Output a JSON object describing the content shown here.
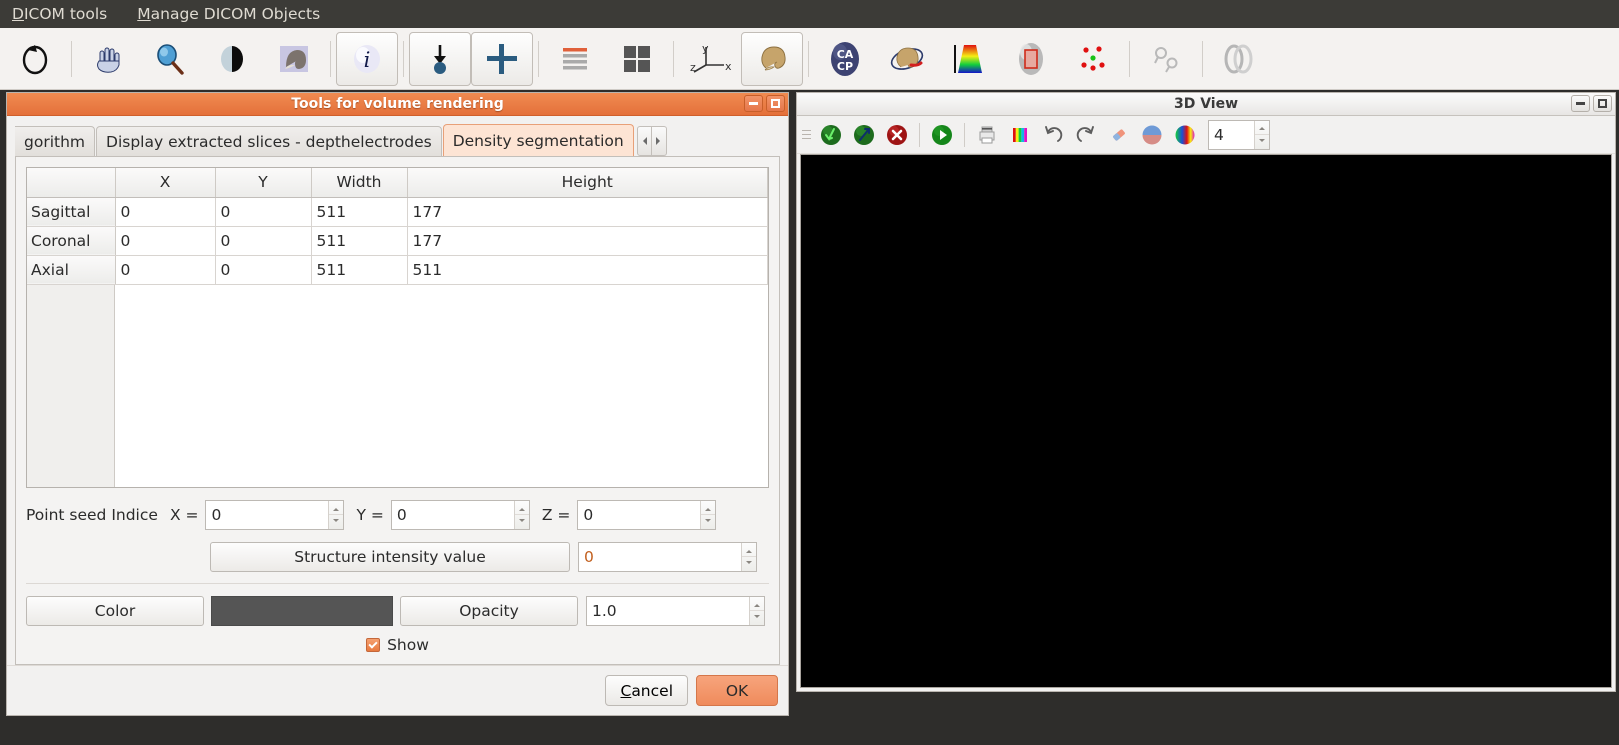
{
  "menubar": {
    "items": [
      {
        "name": "dicom-tools",
        "label": "DICOM tools",
        "accel": "D",
        "rest": "ICOM tools"
      },
      {
        "name": "manage-dicom-objects",
        "label": "Manage DICOM Objects",
        "accel": "M",
        "rest": "anage DICOM Objects"
      }
    ]
  },
  "toolbar": {
    "buttons": [
      {
        "icon": "rotate-icon",
        "label": "Rotate"
      },
      {
        "icon": "pan-hand-icon",
        "label": "Pan"
      },
      {
        "icon": "zoom-magnifier-icon",
        "label": "Zoom"
      },
      {
        "icon": "window-level-contrast-icon",
        "label": "Window level"
      },
      {
        "icon": "volume-render-icon",
        "label": "Volume rendering"
      },
      {
        "icon": "info-icon",
        "label": "Information"
      },
      {
        "icon": "seed-point-icon",
        "label": "Seed point"
      },
      {
        "icon": "crosshair-icon",
        "label": "Crosshair"
      },
      {
        "icon": "single-layout-icon",
        "label": "Single layout"
      },
      {
        "icon": "quad-layout-icon",
        "label": "Quad layout"
      },
      {
        "icon": "axes-orientation-icon",
        "label": "Axes orientation"
      },
      {
        "icon": "skull-3d-icon",
        "label": "3D skull view"
      },
      {
        "icon": "ca-cp-icon",
        "label": "CA CP",
        "text": "CA\nCP"
      },
      {
        "icon": "skull-rotation-icon",
        "label": "Skull rotation"
      },
      {
        "icon": "colormap-ramp-icon",
        "label": "Color map"
      },
      {
        "icon": "roi-box-icon",
        "label": "Region of interest"
      },
      {
        "icon": "points-cloud-icon",
        "label": "Point cloud"
      },
      {
        "icon": "registration-icon",
        "label": "Registration"
      },
      {
        "icon": "fusion-rings-icon",
        "label": "Image fusion"
      }
    ],
    "pressed": [
      "info-icon",
      "seed-point-icon",
      "crosshair-icon",
      "skull-3d-icon"
    ]
  },
  "dialog": {
    "title": "Tools for volume rendering",
    "window_buttons": {
      "minimize": "minimize-button",
      "maximize": "maximize-button"
    },
    "tabs": [
      {
        "label": "gorithm",
        "selected": false,
        "clipped": true
      },
      {
        "label": "Display extracted slices - depthelectrodes",
        "selected": false,
        "clipped": false
      },
      {
        "label": "Density segmentation",
        "selected": true,
        "clipped": false
      }
    ],
    "table": {
      "corner": "",
      "columns": [
        "X",
        "Y",
        "Width",
        "Height"
      ],
      "rows": [
        {
          "header": "Sagittal",
          "cells": [
            "0",
            "0",
            "511",
            "177"
          ]
        },
        {
          "header": "Coronal",
          "cells": [
            "0",
            "0",
            "511",
            "177"
          ]
        },
        {
          "header": "Axial",
          "cells": [
            "0",
            "0",
            "511",
            "511"
          ]
        }
      ]
    },
    "seed": {
      "label": "Point seed Indice",
      "x_label": "X =",
      "x_value": "0",
      "y_label": "Y =",
      "y_value": "0",
      "z_label": "Z =",
      "z_value": "0"
    },
    "intensity": {
      "button_label": "Structure intensity value",
      "value": "0"
    },
    "appearance": {
      "color_button": "Color",
      "color_swatch": "#555555",
      "opacity_button": "Opacity",
      "opacity_value": "1.0"
    },
    "show": {
      "label": "Show",
      "checked": true
    },
    "footer": {
      "cancel": {
        "label": "Cancel",
        "accel": "C",
        "pre": "",
        "rest": "ancel"
      },
      "ok": {
        "label": "OK"
      }
    }
  },
  "view3d": {
    "title": "3D View",
    "window_buttons": {
      "minimize": "minimize-button",
      "maximize": "maximize-button"
    },
    "toolbar": [
      {
        "icon": "green-sphere-down-arrow-icon",
        "label": "Load down"
      },
      {
        "icon": "green-sphere-up-arrow-icon",
        "label": "Load up"
      },
      {
        "icon": "red-close-sphere-icon",
        "label": "Remove"
      },
      {
        "icon": "green-play-sphere-icon",
        "label": "Play"
      },
      {
        "icon": "printer-icon",
        "label": "Print"
      },
      {
        "icon": "color-bars-icon",
        "label": "Color bars"
      },
      {
        "icon": "undo-icon",
        "label": "Undo"
      },
      {
        "icon": "redo-icon",
        "label": "Redo"
      },
      {
        "icon": "eraser-icon",
        "label": "Eraser"
      },
      {
        "icon": "half-sphere-icon",
        "label": "Shading"
      },
      {
        "icon": "rainbow-sphere-icon",
        "label": "Color sphere"
      }
    ],
    "spin_value": "4"
  },
  "colors": {
    "accent": "#e8793f",
    "titlebar_active": "#e4703a",
    "tab_selected_bg": "#fde4d4",
    "canvas": "#000000",
    "desktop": "#2e2d2b",
    "menubar": "#3c3b37"
  }
}
